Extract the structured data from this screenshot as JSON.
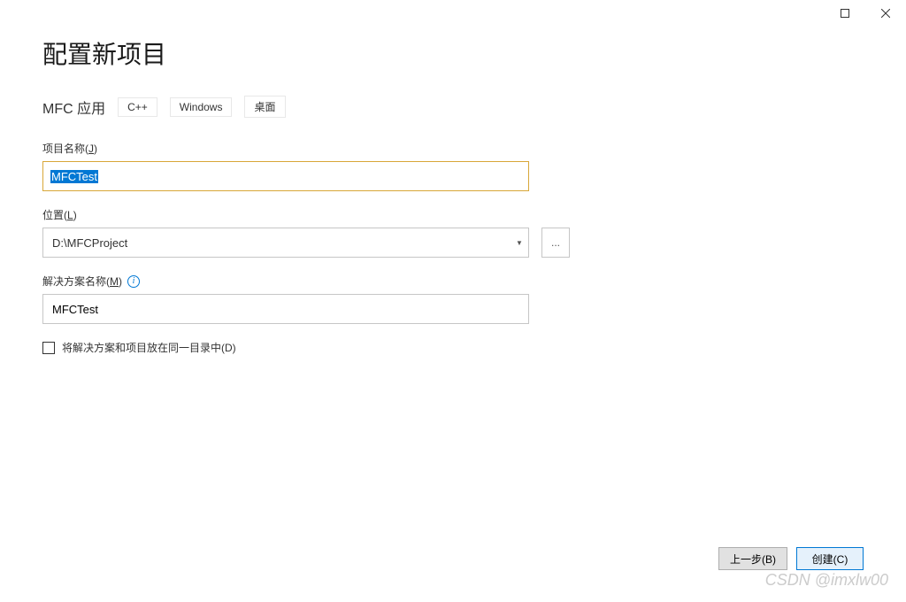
{
  "window": {
    "title": "配置新项目"
  },
  "project": {
    "type_label": "MFC 应用",
    "tags": [
      "C++",
      "Windows",
      "桌面"
    ]
  },
  "fields": {
    "project_name": {
      "label": "项目名称(",
      "accelerator": "J",
      "label_suffix": ")",
      "value": "MFCTest"
    },
    "location": {
      "label": "位置(",
      "accelerator": "L",
      "label_suffix": ")",
      "value": "D:\\MFCProject",
      "browse_label": "..."
    },
    "solution_name": {
      "label": "解决方案名称(",
      "accelerator": "M",
      "label_suffix": ")",
      "value": "MFCTest"
    },
    "same_directory": {
      "label": "将解决方案和项目放在同一目录中(",
      "accelerator": "D",
      "label_suffix": ")",
      "checked": false
    }
  },
  "footer": {
    "back_label": "上一步(",
    "back_accel": "B",
    "back_suffix": ")",
    "create_label": "创建(",
    "create_accel": "C",
    "create_suffix": ")"
  },
  "watermark": "CSDN @imxlw00"
}
